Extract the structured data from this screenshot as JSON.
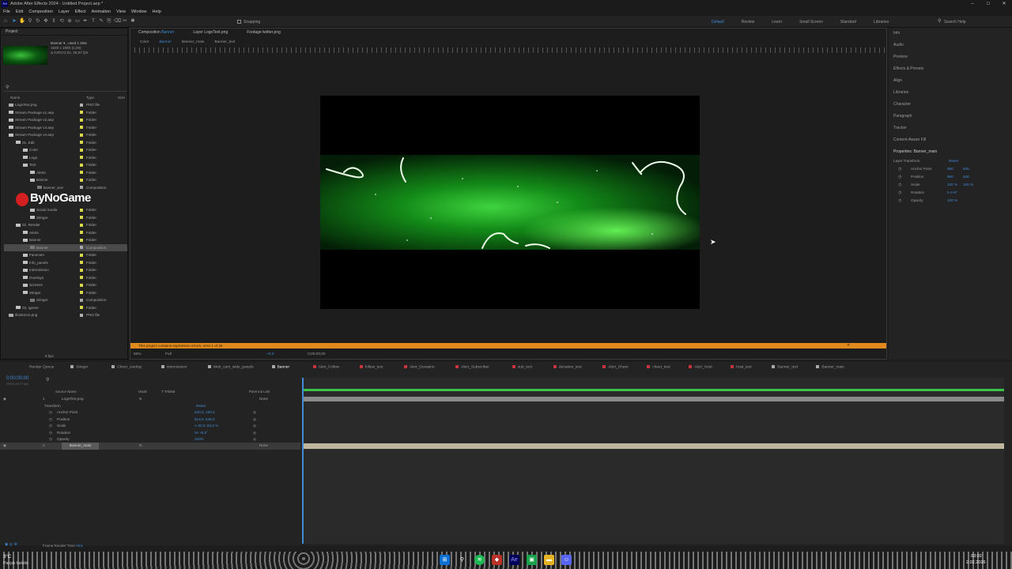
{
  "window": {
    "title": "Adobe After Effects 2024 - Untitled Project.aep *",
    "app_icon": "Ae",
    "min": "–",
    "max": "□",
    "close": "✕"
  },
  "menu": [
    "File",
    "Edit",
    "Composition",
    "Layer",
    "Effect",
    "Animation",
    "View",
    "Window",
    "Help"
  ],
  "toolbar": {
    "snapping": "Snapping",
    "workspaces": [
      "Default",
      "Review",
      "Learn",
      "Small Screen",
      "Standard",
      "Libraries"
    ],
    "search_help": "Search Help"
  },
  "project": {
    "tab": "Project",
    "item_name": "Banner",
    "item_used": "▾ , used 1 time",
    "item_size": "1920 x 1080 (1,00)",
    "item_dur": "Δ 0;00;01;01, 29,97 fps",
    "col_name": "Name",
    "col_type": "Type",
    "col_size": "Size",
    "rows": [
      {
        "name": "LogoText.png",
        "type": "PNG file",
        "indent": 0,
        "icon": "file",
        "label": "#b0b0b0"
      },
      {
        "name": "Stream Package v1.aep",
        "type": "Folder",
        "indent": 0,
        "icon": "folder",
        "label": "#d8d84a"
      },
      {
        "name": "Stream Package v2.aep",
        "type": "Folder",
        "indent": 0,
        "icon": "folder",
        "label": "#d8d84a"
      },
      {
        "name": "Stream Package v3.aep",
        "type": "Folder",
        "indent": 0,
        "icon": "folder",
        "label": "#d8d84a"
      },
      {
        "name": "Stream Package v4.aep",
        "type": "Folder",
        "indent": 0,
        "icon": "folder",
        "label": "#d8d84a"
      },
      {
        "name": "01. Edit",
        "type": "Folder",
        "indent": 1,
        "icon": "folder",
        "label": "#d8d84a"
      },
      {
        "name": "Color",
        "type": "Folder",
        "indent": 2,
        "icon": "folder",
        "label": "#d8d84a"
      },
      {
        "name": "Logo",
        "type": "Folder",
        "indent": 2,
        "icon": "folder",
        "label": "#d8d84a"
      },
      {
        "name": "Text",
        "type": "Folder",
        "indent": 2,
        "icon": "folder",
        "label": "#d8d84a"
      },
      {
        "name": "Alerts",
        "type": "Folder",
        "indent": 3,
        "icon": "folder",
        "label": "#d8d84a"
      },
      {
        "name": "Banner",
        "type": "Folder",
        "indent": 3,
        "icon": "folder",
        "label": "#d8d84a"
      },
      {
        "name": "Banner_text",
        "type": "Composition",
        "indent": 4,
        "icon": "comp",
        "label": "#a8a8a8"
      },
      {
        "name": "",
        "type": "",
        "indent": 4,
        "icon": "none",
        "label": ""
      },
      {
        "name": "",
        "type": "",
        "indent": 4,
        "icon": "none",
        "label": ""
      },
      {
        "name": "Social media",
        "type": "Folder",
        "indent": 3,
        "icon": "folder",
        "label": "#d8d84a"
      },
      {
        "name": "Stinger",
        "type": "Folder",
        "indent": 3,
        "icon": "folder",
        "label": "#d8d84a"
      },
      {
        "name": "02. Render",
        "type": "Folder",
        "indent": 1,
        "icon": "folder",
        "label": "#d8d84a"
      },
      {
        "name": "Alerts",
        "type": "Folder",
        "indent": 2,
        "icon": "folder",
        "label": "#d8d84a"
      },
      {
        "name": "Banner",
        "type": "Folder",
        "indent": 2,
        "icon": "folder",
        "label": "#d8d84a"
      },
      {
        "name": "Banner",
        "type": "Composition",
        "indent": 3,
        "icon": "comp",
        "label": "#a8a8a8",
        "selected": true
      },
      {
        "name": "Facecam",
        "type": "Folder",
        "indent": 2,
        "icon": "folder",
        "label": "#d8d84a"
      },
      {
        "name": "Info_panels",
        "type": "Folder",
        "indent": 2,
        "icon": "folder",
        "label": "#d8d84a"
      },
      {
        "name": "Intermission",
        "type": "Folder",
        "indent": 2,
        "icon": "folder",
        "label": "#d8d84a"
      },
      {
        "name": "Overlays",
        "type": "Folder",
        "indent": 2,
        "icon": "folder",
        "label": "#d8d84a"
      },
      {
        "name": "Screens",
        "type": "Folder",
        "indent": 2,
        "icon": "folder",
        "label": "#d8d84a"
      },
      {
        "name": "Stinger",
        "type": "Folder",
        "indent": 2,
        "icon": "folder",
        "label": "#d8d84a"
      },
      {
        "name": "Stinger",
        "type": "Composition",
        "indent": 3,
        "icon": "comp",
        "label": "#a8a8a8"
      },
      {
        "name": "03. Ignore",
        "type": "Folder",
        "indent": 1,
        "icon": "folder",
        "label": "#d8d84a"
      },
      {
        "name": "tiktokIcon.png",
        "type": "PNG file",
        "indent": 0,
        "icon": "file",
        "label": "#b0b0b0"
      }
    ],
    "bpc": "8 bpc"
  },
  "watermark": "ByNoGame",
  "viewer": {
    "tabs": [
      {
        "label": "Composition",
        "sub": "Banner"
      },
      {
        "label": "Layer",
        "sub": "LogoText.png"
      },
      {
        "label": "Footage",
        "sub": "twitter.png"
      }
    ],
    "crumbs": [
      "Color",
      "Banner",
      "Banner_main",
      "Banner_text"
    ],
    "zoom": "50%",
    "resolution": "Full",
    "timecode": "0;00;00;00",
    "plus": "+0,0",
    "error": "This project contains expression errors: error 1 of 26"
  },
  "right_panel": {
    "items": [
      "Info",
      "Audio",
      "Preview",
      "Effects & Presets",
      "Align",
      "Libraries",
      "Character",
      "Paragraph",
      "Tracker",
      "Content-Aware Fill"
    ],
    "props_title": "Properties: Banner_main",
    "layer_transform": "Layer Transform",
    "reset": "Reset",
    "props": [
      {
        "name": "Anchor Point",
        "v1": "960",
        "v2": "540"
      },
      {
        "name": "Position",
        "v1": "960",
        "v2": "540"
      },
      {
        "name": "Scale",
        "v1": "100 %",
        "v2": "100 %"
      },
      {
        "name": "Rotation",
        "v1": "0 x+0°",
        "v2": ""
      },
      {
        "name": "Opacity",
        "v1": "100 %",
        "v2": ""
      }
    ]
  },
  "timeline": {
    "tabs": [
      {
        "label": "Render Queue",
        "color": "#00000000"
      },
      {
        "label": "Stinger",
        "color": "#a8a8a8"
      },
      {
        "label": "Cheer_overlay",
        "color": "#a8a8a8"
      },
      {
        "label": "Intermission",
        "color": "#a8a8a8"
      },
      {
        "label": "Web_cam_wide_panels",
        "color": "#a8a8a8"
      },
      {
        "label": "Banner",
        "color": "#a8a8a8"
      },
      {
        "label": "Alert_Follow",
        "color": "#c4343a"
      },
      {
        "label": "follow_text",
        "color": "#c4343a"
      },
      {
        "label": "Alert_Donation",
        "color": "#c4343a"
      },
      {
        "label": "Alert_Subscriber",
        "color": "#c4343a"
      },
      {
        "label": "sub_text",
        "color": "#c4343a"
      },
      {
        "label": "donation_text",
        "color": "#c4343a"
      },
      {
        "label": "Alert_Cheer",
        "color": "#c4343a"
      },
      {
        "label": "cheer_text",
        "color": "#c4343a"
      },
      {
        "label": "Alert_Host",
        "color": "#c4343a"
      },
      {
        "label": "host_text",
        "color": "#c4343a"
      },
      {
        "label": "Banner_text",
        "color": "#a8a8a8"
      },
      {
        "label": "Banner_main",
        "color": "#a8a8a8"
      }
    ],
    "timecode": "0;00;00;00",
    "fps": "00000 (29.97 fps)",
    "col_source": "Source Name",
    "col_mode": "Mode",
    "col_trkmat": "T TrkMat",
    "col_parent": "Parent & Link",
    "layers": [
      {
        "num": "1",
        "name": "LogoText.png",
        "mode": "N",
        "parent": "None"
      },
      {
        "num": "2",
        "name": "Banner_main",
        "mode": "N",
        "parent": "None"
      }
    ],
    "transform": "Transform",
    "reset": "Reset",
    "props": [
      {
        "name": "Anchor Point",
        "value": "540,0, 160,0"
      },
      {
        "name": "Position",
        "value": "613,0, 546,0"
      },
      {
        "name": "Scale",
        "value": "∞ 82,0, 82,0 %"
      },
      {
        "name": "Rotation",
        "value": "0x +0,0°"
      },
      {
        "name": "Opacity",
        "value": "100%"
      }
    ],
    "render_time_label": "Frame Render Time",
    "render_time": "0ms"
  },
  "taskbar": {
    "weather_temp": "3°C",
    "weather_desc": "Parçalı bulutlu",
    "time": "03:02",
    "date": "2.02.2026"
  }
}
